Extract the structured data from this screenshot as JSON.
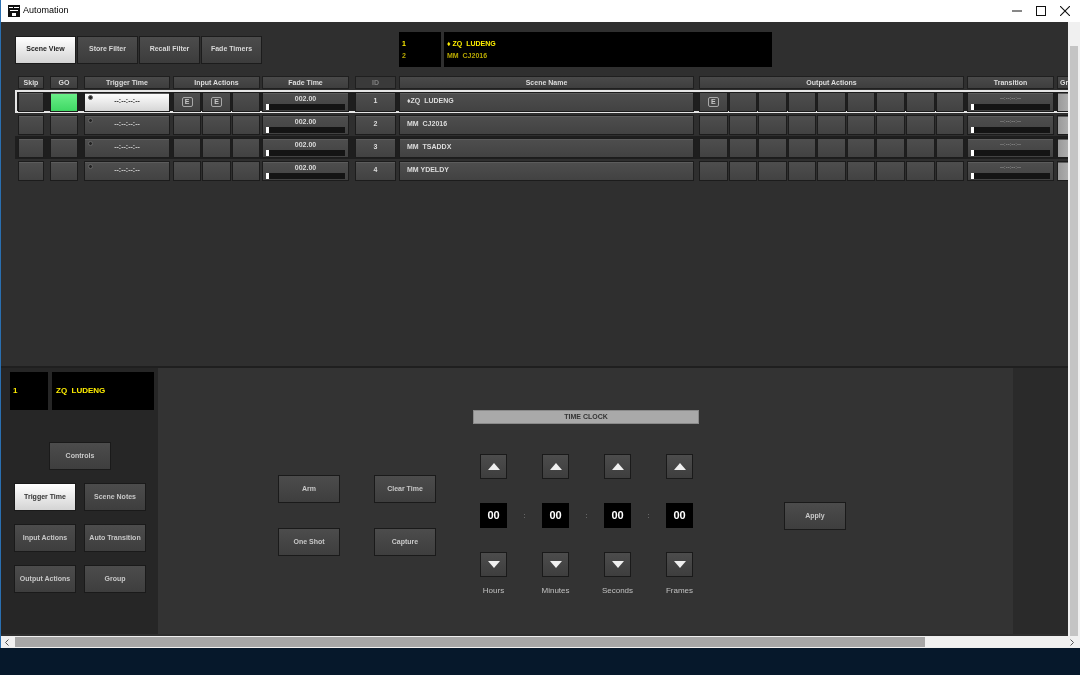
{
  "window": {
    "title": "Automation"
  },
  "tabs": [
    {
      "label": "Scene View",
      "selected": true
    },
    {
      "label": "Store Filter",
      "selected": false
    },
    {
      "label": "Recall Filter",
      "selected": false
    },
    {
      "label": "Fade Timers",
      "selected": false
    }
  ],
  "scene_list_display": [
    {
      "id": "1",
      "name": "♦ ZQ  LUDENG",
      "current": true
    },
    {
      "id": "2",
      "name": "MM  CJ2016",
      "current": false
    }
  ],
  "table": {
    "columns": [
      {
        "label": "Skip",
        "disabled": false
      },
      {
        "label": "GO",
        "disabled": false
      },
      {
        "label": "Trigger Time",
        "disabled": false
      },
      {
        "label": "Input Actions",
        "disabled": false
      },
      {
        "label": "Fade Time",
        "disabled": false
      },
      {
        "label": "ID",
        "disabled": true
      },
      {
        "label": "Scene Name",
        "disabled": false
      },
      {
        "label": "Output Actions",
        "disabled": false
      },
      {
        "label": "Transition",
        "disabled": false
      },
      {
        "label": "Gr",
        "disabled": false
      }
    ],
    "rows": [
      {
        "selected": true,
        "go": {
          "on": true
        },
        "trigger": {
          "text": "--:--:--:--",
          "selected": true
        },
        "input_actions": [
          {
            "kind": "edit",
            "label": "E"
          },
          {
            "kind": "edit",
            "label": "E"
          },
          {
            "kind": "empty"
          }
        ],
        "fade": {
          "text": "002.00",
          "level": 0.04
        },
        "id": "1",
        "scene_name": "♦ZQ  LUDENG",
        "output_actions": [
          {
            "kind": "edit",
            "label": "E"
          },
          {
            "kind": "empty"
          },
          {
            "kind": "empty"
          },
          {
            "kind": "empty"
          },
          {
            "kind": "empty"
          },
          {
            "kind": "empty"
          },
          {
            "kind": "empty"
          },
          {
            "kind": "empty"
          },
          {
            "kind": "empty"
          }
        ],
        "transition": {
          "text": "--:--:--:--",
          "level": 0.04
        }
      },
      {
        "selected": false,
        "go": {
          "on": false
        },
        "trigger": {
          "text": "--:--:--:--",
          "selected": false
        },
        "input_actions": [
          {
            "kind": "empty"
          },
          {
            "kind": "empty"
          },
          {
            "kind": "empty"
          }
        ],
        "fade": {
          "text": "002.00",
          "level": 0.04
        },
        "id": "2",
        "scene_name": "MM  CJ2016",
        "output_actions": [
          {
            "kind": "empty"
          },
          {
            "kind": "empty"
          },
          {
            "kind": "empty"
          },
          {
            "kind": "empty"
          },
          {
            "kind": "empty"
          },
          {
            "kind": "empty"
          },
          {
            "kind": "empty"
          },
          {
            "kind": "empty"
          },
          {
            "kind": "empty"
          }
        ],
        "transition": {
          "text": "--:--:--:--",
          "level": 0.04
        }
      },
      {
        "selected": false,
        "go": {
          "on": false
        },
        "trigger": {
          "text": "--:--:--:--",
          "selected": false
        },
        "input_actions": [
          {
            "kind": "empty"
          },
          {
            "kind": "empty"
          },
          {
            "kind": "empty"
          }
        ],
        "fade": {
          "text": "002.00",
          "level": 0.04
        },
        "id": "3",
        "scene_name": "MM  TSADDX",
        "output_actions": [
          {
            "kind": "empty"
          },
          {
            "kind": "empty"
          },
          {
            "kind": "empty"
          },
          {
            "kind": "empty"
          },
          {
            "kind": "empty"
          },
          {
            "kind": "empty"
          },
          {
            "kind": "empty"
          },
          {
            "kind": "empty"
          },
          {
            "kind": "empty"
          }
        ],
        "transition": {
          "text": "--:--:--:--",
          "level": 0.04
        }
      },
      {
        "selected": false,
        "go": {
          "on": false
        },
        "trigger": {
          "text": "--:--:--:--",
          "selected": false
        },
        "input_actions": [
          {
            "kind": "empty"
          },
          {
            "kind": "empty"
          },
          {
            "kind": "empty"
          }
        ],
        "fade": {
          "text": "002.00",
          "level": 0.04
        },
        "id": "4",
        "scene_name": "MM YDELDY",
        "output_actions": [
          {
            "kind": "empty"
          },
          {
            "kind": "empty"
          },
          {
            "kind": "empty"
          },
          {
            "kind": "empty"
          },
          {
            "kind": "empty"
          },
          {
            "kind": "empty"
          },
          {
            "kind": "empty"
          },
          {
            "kind": "empty"
          },
          {
            "kind": "empty"
          }
        ],
        "transition": {
          "text": "--:--:--:--",
          "level": 0.04
        }
      }
    ]
  },
  "current_scene": {
    "id": "1",
    "name": "ZQ  LUDENG"
  },
  "panel_buttons": [
    {
      "label": "Controls",
      "selected": false
    },
    {
      "label": "Trigger Time",
      "selected": true
    },
    {
      "label": "Scene Notes",
      "selected": false
    },
    {
      "label": "Input Actions",
      "selected": false
    },
    {
      "label": "Auto Transition",
      "selected": false
    },
    {
      "label": "Output Actions",
      "selected": false
    },
    {
      "label": "Group",
      "selected": false
    }
  ],
  "trigger_actions": [
    "Arm",
    "Clear Time",
    "One Shot",
    "Capture"
  ],
  "time_clock": {
    "title": "TIME CLOCK",
    "fields": [
      {
        "value": "00",
        "label": "Hours"
      },
      {
        "value": "00",
        "label": "Minutes"
      },
      {
        "value": "00",
        "label": "Seconds"
      },
      {
        "value": "00",
        "label": "Frames"
      }
    ],
    "separators": [
      ":",
      ":",
      ":"
    ],
    "apply": "Apply"
  }
}
